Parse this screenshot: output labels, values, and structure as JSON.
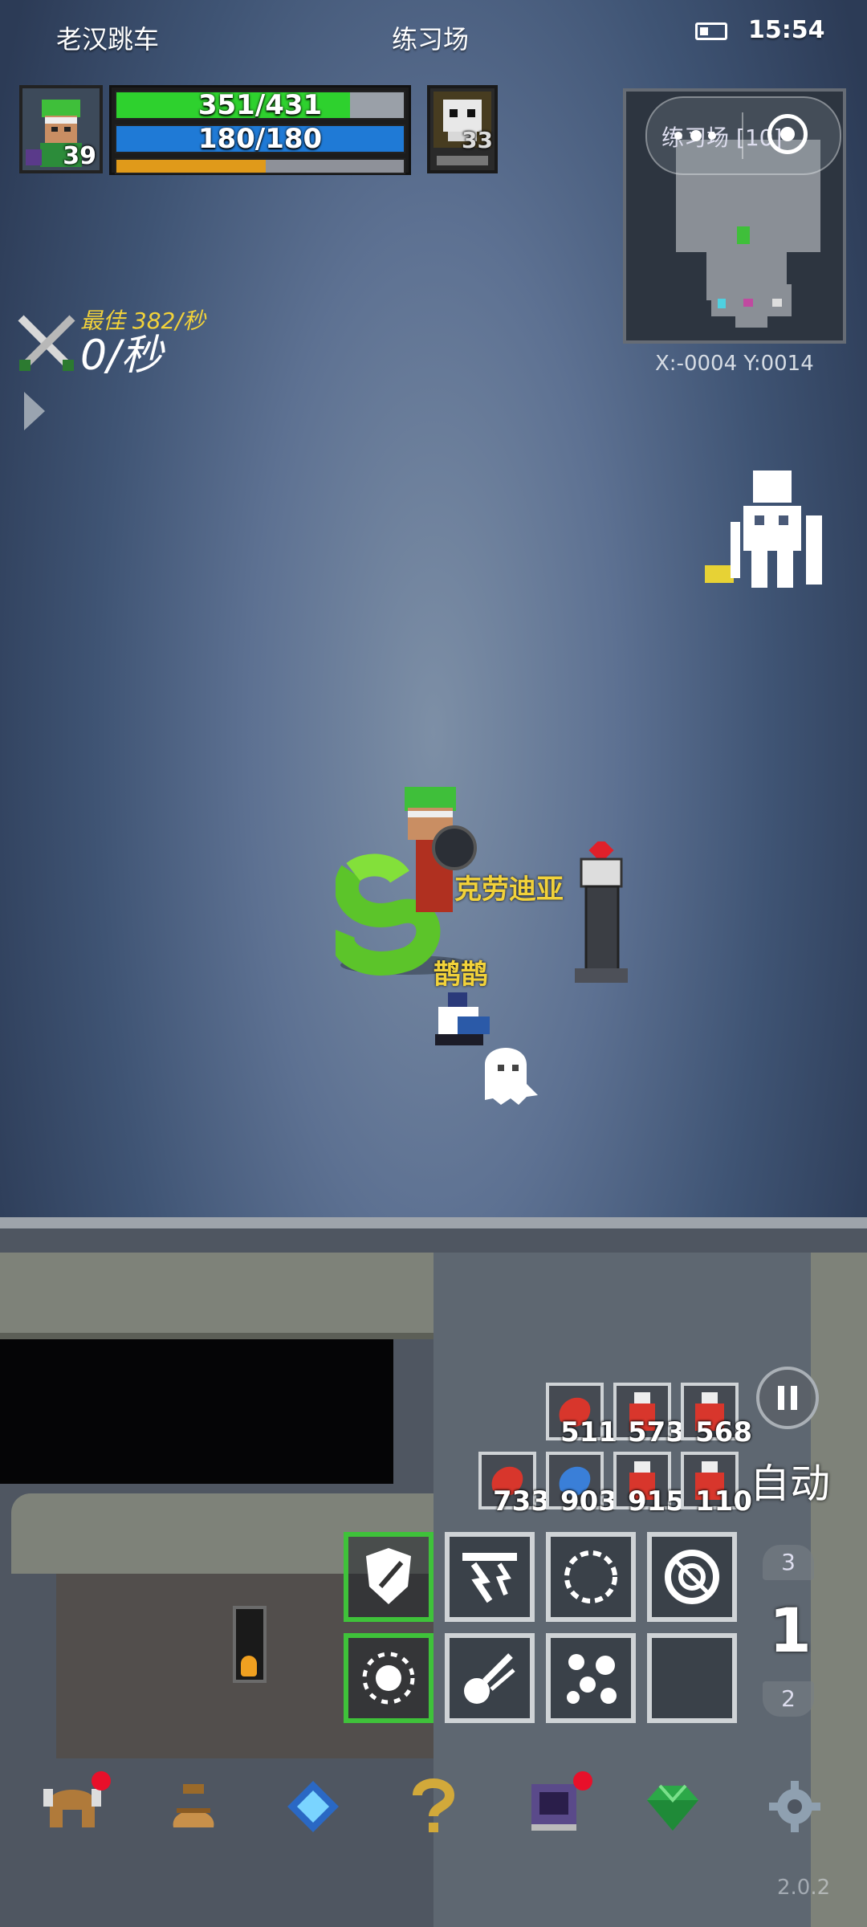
{
  "status_bar": {
    "left": "老汉跳车",
    "center": "练习场",
    "time": "15:54"
  },
  "player": {
    "level": "39",
    "hp": "351/431",
    "hp_fraction": 0.814,
    "mp": "180/180",
    "mp_fraction": 1.0,
    "xp_fraction": 0.52
  },
  "enemy": {
    "level": "33"
  },
  "minimap": {
    "title": "练习场 [10]",
    "coords": "X:-0004 Y:0014"
  },
  "dps": {
    "best": "最佳 382/秒",
    "current": "0/秒"
  },
  "names": {
    "boss": "克劳迪亚",
    "pet": "鹊鹊"
  },
  "potions": [
    {
      "count": "511",
      "color": "#d8362c"
    },
    {
      "count": "573",
      "color": "#d8362c"
    },
    {
      "count": "568",
      "color": "#d8362c"
    },
    {
      "count": "733",
      "color": "#d8362c"
    },
    {
      "count": "903",
      "color": "#3a7fd8"
    },
    {
      "count": "915",
      "color": "#d8362c"
    },
    {
      "count": "110",
      "color": "#d8362c"
    }
  ],
  "controls": {
    "auto": "自动",
    "speed_up": "3",
    "speed_current": "1",
    "speed_down": "2"
  },
  "skills": [
    {
      "icon": "shield-skill-icon",
      "active": true
    },
    {
      "icon": "lightning-skill-icon",
      "active": false
    },
    {
      "icon": "ring-skill-icon",
      "active": false
    },
    {
      "icon": "spiral-skill-icon",
      "active": false
    },
    {
      "icon": "burst-skill-icon",
      "active": true
    },
    {
      "icon": "comet-skill-icon",
      "active": false
    },
    {
      "icon": "scatter-skill-icon",
      "active": false
    },
    {
      "icon": "empty-skill-slot",
      "active": false
    }
  ],
  "bottom_nav": [
    {
      "icon": "helmet-icon",
      "badge": true
    },
    {
      "icon": "bag-icon",
      "badge": false
    },
    {
      "icon": "gem-icon",
      "badge": false
    },
    {
      "icon": "question-icon",
      "badge": false
    },
    {
      "icon": "book-icon",
      "badge": true
    },
    {
      "icon": "emerald-icon",
      "badge": false
    },
    {
      "icon": "gear-icon",
      "badge": false
    }
  ],
  "version": "2.0.2"
}
